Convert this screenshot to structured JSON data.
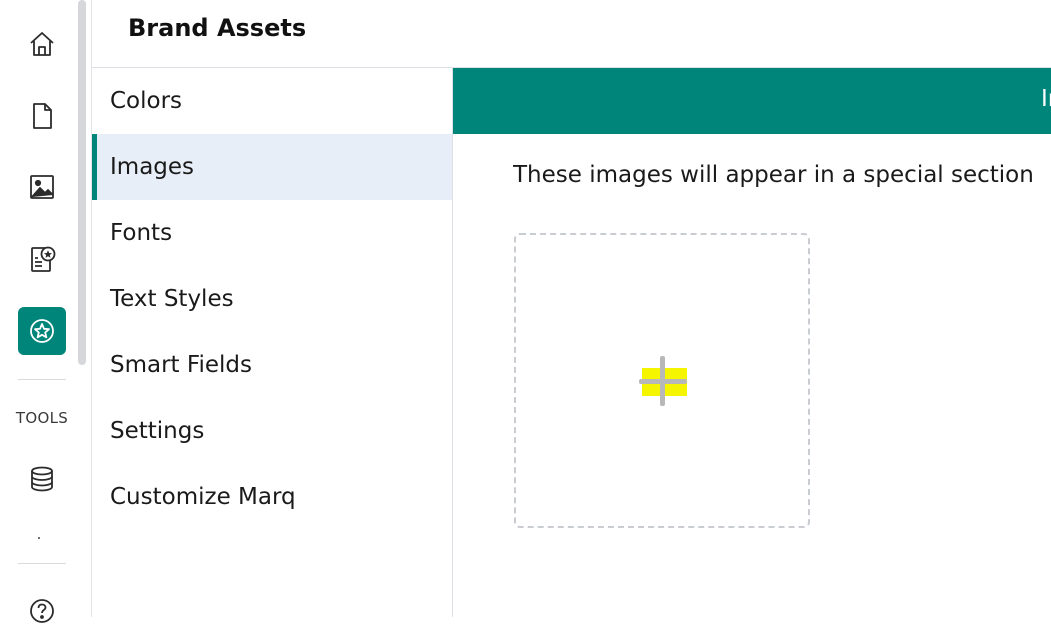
{
  "header": {
    "title": "Brand Assets"
  },
  "rail": {
    "items": [
      {
        "icon": "home-icon"
      },
      {
        "icon": "document-icon"
      },
      {
        "icon": "image-icon"
      },
      {
        "icon": "template-star-icon"
      },
      {
        "icon": "brand-star-icon",
        "active": true
      },
      {
        "icon": "database-icon"
      },
      {
        "icon": "help-icon"
      }
    ],
    "section_label": "TOOLS"
  },
  "subnav": {
    "items": [
      {
        "label": "Colors"
      },
      {
        "label": "Images",
        "active": true
      },
      {
        "label": "Fonts"
      },
      {
        "label": "Text Styles"
      },
      {
        "label": "Smart Fields"
      },
      {
        "label": "Settings"
      },
      {
        "label": "Customize Marq"
      }
    ]
  },
  "main": {
    "banner_text": "Ir",
    "description": "These images will appear in a special section",
    "dropzone_icon": "plus-icon"
  },
  "colors": {
    "accent": "#00857a",
    "active_bg": "#e8eef8",
    "highlight": "#f5f500"
  }
}
